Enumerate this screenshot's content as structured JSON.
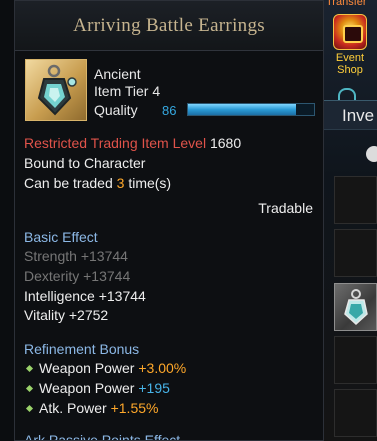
{
  "background": {
    "transfer_label": "Transfer",
    "event_shop": {
      "label_line1": "Event",
      "label_line2": "Shop"
    },
    "inventory_tab": "Inve"
  },
  "tooltip": {
    "title": "Arriving Battle Earrings",
    "item": {
      "grade": "Ancient",
      "tier": "Item Tier 4",
      "quality_label": "Quality",
      "quality_value": "86",
      "quality_fraction": 0.86
    },
    "restricted": {
      "label": "Restricted Trading Item Level",
      "value": "1680"
    },
    "bound": "Bound to Character",
    "trade": {
      "prefix": "Can be traded",
      "count": "3",
      "suffix": "time(s)"
    },
    "tradable": "Tradable",
    "basic_effect": {
      "heading": "Basic Effect",
      "stats": [
        {
          "name": "Strength",
          "value": "+13744"
        },
        {
          "name": "Dexterity",
          "value": "+13744"
        },
        {
          "name": "Intelligence",
          "value": "+13744"
        },
        {
          "name": "Vitality",
          "value": "+2752"
        }
      ]
    },
    "refinement_bonus": {
      "heading": "Refinement Bonus",
      "items": [
        {
          "name": "Weapon Power",
          "value": "+3.00%"
        },
        {
          "name": "Weapon Power",
          "value": "+195"
        },
        {
          "name": "Atk. Power",
          "value": "+1.55%"
        }
      ]
    },
    "ark_passive": {
      "heading": "Ark Passive Points Effect"
    }
  },
  "colors": {
    "title": "#c6b48f",
    "restricted": "#e0534a",
    "heading": "#8cb8e6",
    "orange_value": "#ffa82a",
    "blue_value": "#47b3e8",
    "disabled": "#767676"
  }
}
